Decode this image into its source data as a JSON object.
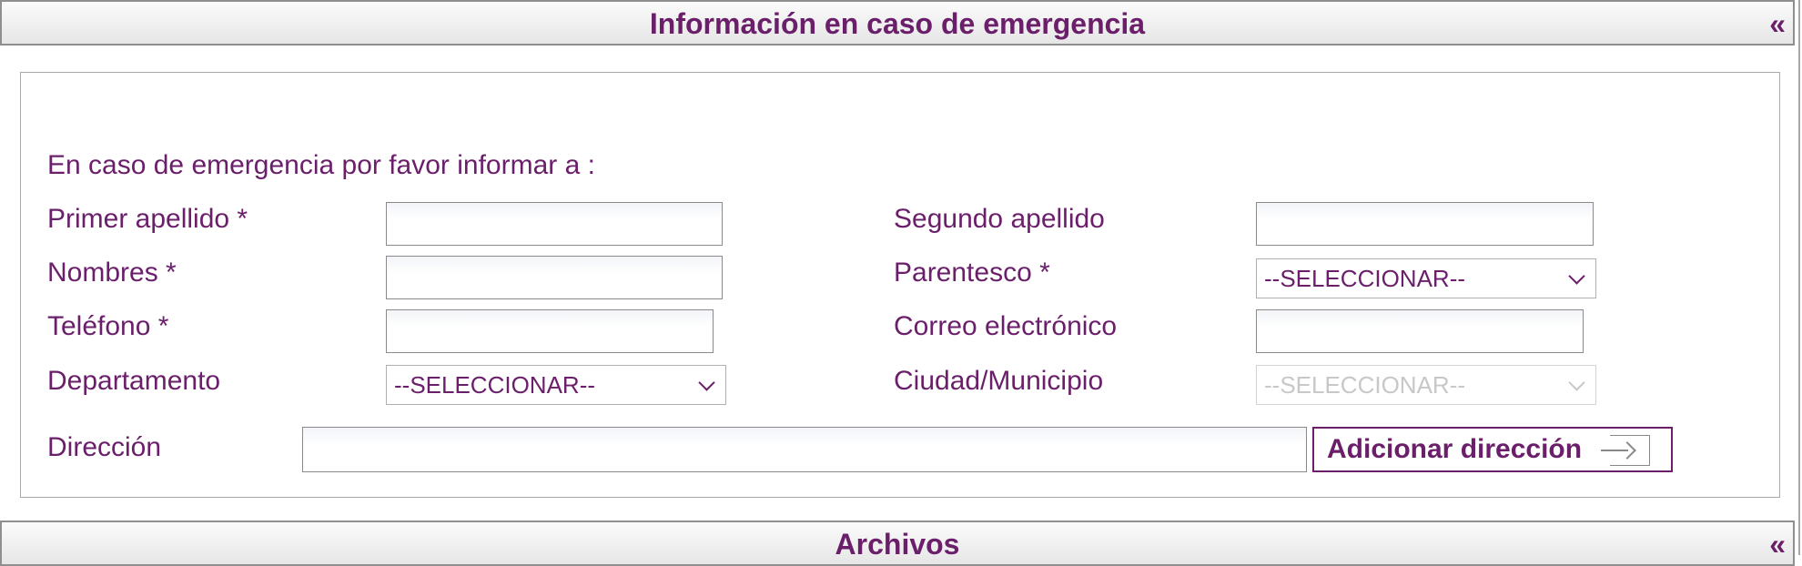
{
  "emergency_section": {
    "title": "Información en caso de emergencia",
    "collapse_icon": "«"
  },
  "form": {
    "intro": "En caso de emergencia por favor informar a :",
    "primer_apellido": {
      "label": "Primer apellido *",
      "value": ""
    },
    "segundo_apellido": {
      "label": "Segundo apellido",
      "value": ""
    },
    "nombres": {
      "label": "Nombres *",
      "value": ""
    },
    "parentesco": {
      "label": "Parentesco *",
      "selected": "--SELECCIONAR--"
    },
    "telefono": {
      "label": "Teléfono *",
      "value": ""
    },
    "correo": {
      "label": "Correo electrónico",
      "value": ""
    },
    "departamento": {
      "label": "Departamento",
      "selected": "--SELECCIONAR--"
    },
    "ciudad": {
      "label": "Ciudad/Municipio",
      "selected": "--SELECCIONAR--",
      "disabled": true
    },
    "direccion": {
      "label": "Dirección",
      "value": ""
    },
    "add_address_button": {
      "label": "Adicionar dirección",
      "icon": "arrow-right-icon"
    }
  },
  "files_section": {
    "title": "Archivos",
    "collapse_icon": "«"
  },
  "colors": {
    "accent": "#6b1f6b",
    "border": "#8f8f8f",
    "header_bg": "#eeeeee",
    "disabled_text": "#c8c8c8"
  }
}
